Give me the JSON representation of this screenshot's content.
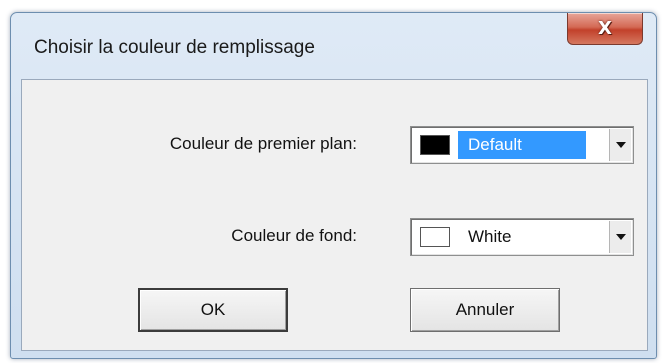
{
  "window": {
    "title": "Choisir la couleur de remplissage",
    "close_label": "X"
  },
  "foreground": {
    "label": "Couleur de premier plan:",
    "value": "Default",
    "swatch_color": "#000000"
  },
  "background": {
    "label": "Couleur de fond:",
    "value": "White",
    "swatch_color": "#ffffff"
  },
  "buttons": {
    "ok": "OK",
    "cancel": "Annuler"
  },
  "colors": {
    "selection": "#3399ff",
    "close_button": "#c2412b"
  },
  "icons": {
    "close": "close-icon",
    "dropdown": "chevron-down-icon"
  }
}
